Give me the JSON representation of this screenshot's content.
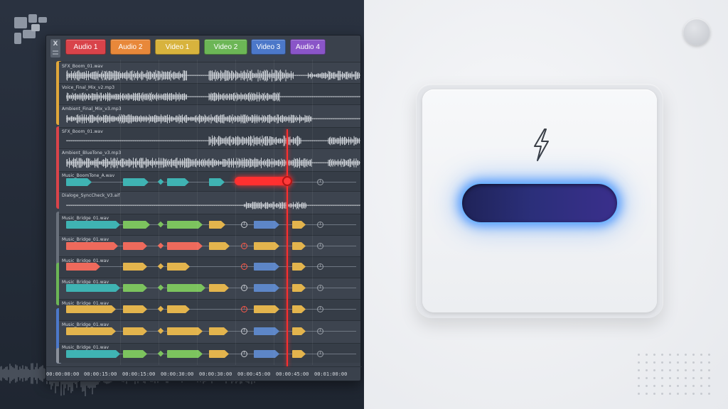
{
  "editor": {
    "corner_label": "X",
    "tabs": [
      {
        "label": "Audio 1",
        "color": "#d9434a"
      },
      {
        "label": "Audio 2",
        "color": "#e8883a"
      },
      {
        "label": "Video 1",
        "color": "#d8b33d"
      },
      {
        "label": "Video 2",
        "color": "#6cb656"
      },
      {
        "label": "Video 3",
        "color": "#4c78c9"
      },
      {
        "label": "Audio 4",
        "color": "#8a55c8"
      }
    ],
    "tracks": [
      {
        "label": "SFX_Boom_01.wav"
      },
      {
        "label": "Voice_Final_Mix_v2.mp3"
      },
      {
        "label": "Ambient_Final_Mix_v3.mp3"
      },
      {
        "label": "SFX_Boom_01.wav"
      },
      {
        "label": "Ambient_BlueTone_v3.mp3"
      },
      {
        "label": "Music_BoomTone_A.wav"
      },
      {
        "label": "Dialoge_SyncCheck_V3.aif"
      },
      {
        "label": "Music_Bridge_01.wav"
      },
      {
        "label": "Music_Bridge_01.wav"
      },
      {
        "label": "Music_Bridge_01.wav"
      },
      {
        "label": "Music_Bridge_01.wav"
      },
      {
        "label": "Music_Bridge_01.wav"
      },
      {
        "label": "Music_Bridge_01.wav"
      },
      {
        "label": "Music_Bridge_01.wav"
      }
    ],
    "timeline_ticks": [
      "00:00:00:00",
      "00:00:15:00",
      "00:00:15:00",
      "00:00:30:00",
      "00:00:30:00",
      "00:00:45:00",
      "00:00:45:00",
      "00:01:00:00"
    ],
    "playhead_color": "#ff2e2e"
  },
  "panel": {
    "icon": "lightning-bolt-icon",
    "toggle_state": "on",
    "glow_color": "#3a8cff"
  }
}
